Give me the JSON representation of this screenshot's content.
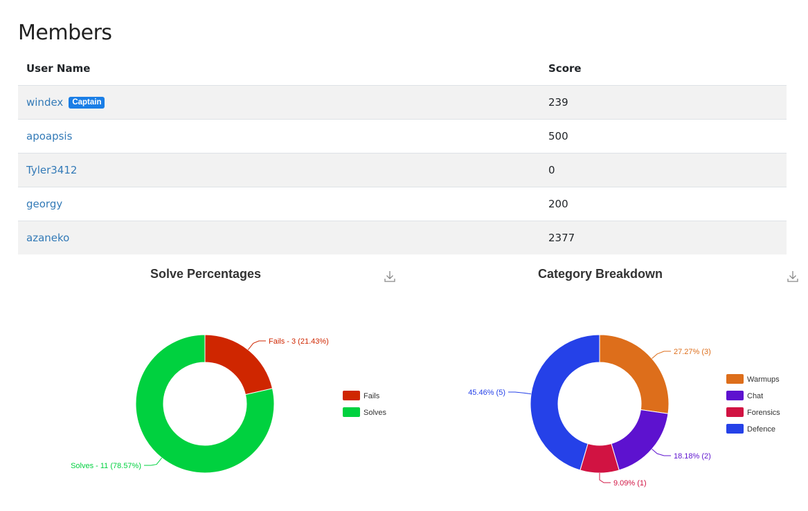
{
  "page": {
    "title": "Members"
  },
  "table": {
    "headers": {
      "user": "User Name",
      "score": "Score"
    },
    "rows": [
      {
        "name": "windex",
        "badge": "Captain",
        "score": "239"
      },
      {
        "name": "apoapsis",
        "badge": "",
        "score": "500"
      },
      {
        "name": "Tyler3412",
        "badge": "",
        "score": "0"
      },
      {
        "name": "georgy",
        "badge": "",
        "score": "200"
      },
      {
        "name": "azaneko",
        "badge": "",
        "score": "2377"
      }
    ]
  },
  "chart_data": [
    {
      "type": "pie",
      "variant": "donut",
      "title": "Solve Percentages",
      "legend_position": "right",
      "labels": [
        "Fails",
        "Solves"
      ],
      "values": [
        3,
        11
      ],
      "colors": [
        "#cf2600",
        "#00d13f"
      ],
      "slice_labels": [
        "Fails - 3 (21.43%)",
        "Solves - 11 (78.57%)"
      ]
    },
    {
      "type": "pie",
      "variant": "donut",
      "title": "Category Breakdown",
      "legend_position": "right",
      "labels": [
        "Warmups",
        "Chat",
        "Forensics",
        "Defence"
      ],
      "values": [
        3,
        2,
        1,
        5
      ],
      "colors": [
        "#dd6e1b",
        "#5d12cf",
        "#d11342",
        "#2541e8"
      ],
      "slice_labels": [
        "27.27% (3)",
        "18.18% (2)",
        "9.09% (1)",
        "45.46% (5)"
      ]
    }
  ]
}
